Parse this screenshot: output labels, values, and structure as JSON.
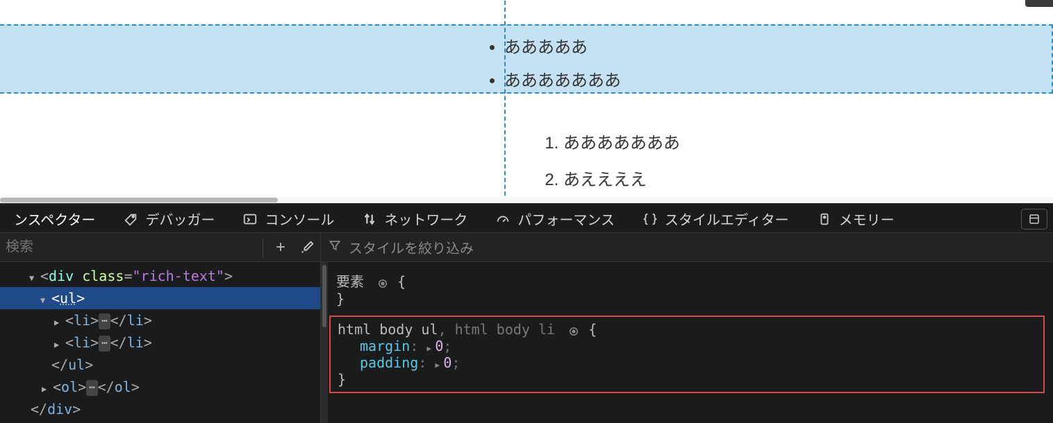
{
  "page": {
    "ul_items": [
      "あああああ",
      "あああああああ"
    ],
    "ol_items": [
      "あああああああ",
      "あええええ"
    ]
  },
  "devtools": {
    "tabs": {
      "inspector": "ンスペクター",
      "debugger": "デバッガー",
      "console": "コンソール",
      "network": "ネットワーク",
      "performance": "パフォーマンス",
      "style_editor": "スタイルエディター",
      "memory": "メモリー"
    },
    "dom_panel": {
      "search_placeholder": "検索",
      "tree": {
        "div_open": "<div class=\"rich-text\">",
        "ul_open": "<ul>",
        "li1_open": "<li>",
        "li1_close": "</li>",
        "li2_open": "<li>",
        "li2_close": "</li>",
        "ul_close": "</ul>",
        "ol_open": "<ol>",
        "ol_close": "</ol>",
        "div_close": "</div>",
        "ellipsis": "⋯"
      }
    },
    "styles_panel": {
      "filter_placeholder": "スタイルを絞り込み",
      "element_rule": {
        "selector": "要素",
        "open_brace": "{",
        "close_brace": "}"
      },
      "css_rule": {
        "selector1": "html body ul",
        "comma": ", ",
        "selector2": "html body li",
        "open_brace": "{",
        "props": {
          "margin": {
            "name": "margin",
            "value": "0"
          },
          "padding": {
            "name": "padding",
            "value": "0"
          }
        },
        "close_brace": "}"
      }
    }
  }
}
